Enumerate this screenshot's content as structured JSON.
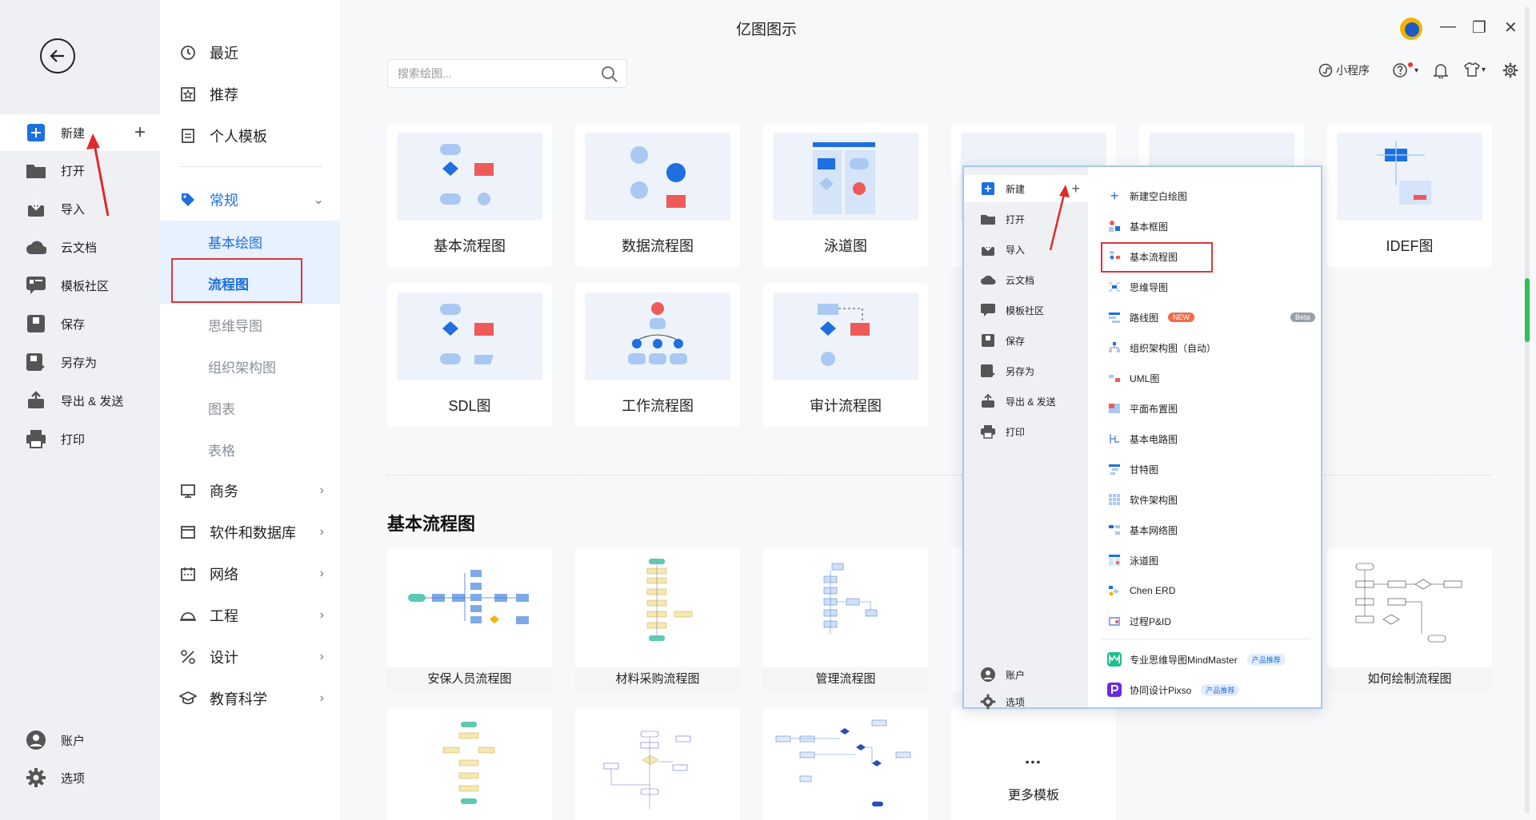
{
  "app": {
    "title": "亿图图示"
  },
  "rail": {
    "items": [
      {
        "label": "新建",
        "icon": "plus-square-icon"
      },
      {
        "label": "打开",
        "icon": "folder-icon"
      },
      {
        "label": "导入",
        "icon": "import-icon"
      },
      {
        "label": "云文档",
        "icon": "cloud-icon"
      },
      {
        "label": "模板社区",
        "icon": "community-icon"
      },
      {
        "label": "保存",
        "icon": "save-icon"
      },
      {
        "label": "另存为",
        "icon": "save-as-icon"
      },
      {
        "label": "导出 & 发送",
        "icon": "export-icon"
      },
      {
        "label": "打印",
        "icon": "print-icon"
      }
    ],
    "bottom": [
      {
        "label": "账户",
        "icon": "user-icon"
      },
      {
        "label": "选项",
        "icon": "gear-icon"
      }
    ]
  },
  "categories": {
    "top": [
      "最近",
      "推荐",
      "个人模板"
    ],
    "group": "常规",
    "sub": [
      "基本绘图",
      "流程图",
      "思维导图",
      "组织架构图",
      "图表",
      "表格"
    ],
    "more": [
      "商务",
      "软件和数据库",
      "网络",
      "工程",
      "设计",
      "教育科学"
    ]
  },
  "search": {
    "placeholder": "搜索绘图..."
  },
  "toolbar": {
    "miniprogram": "小程序"
  },
  "types": [
    "基本流程图",
    "数据流程图",
    "泳道图",
    "IDEF图",
    "SDL图",
    "工作流程图",
    "审计流程图"
  ],
  "section": {
    "title": "基本流程图"
  },
  "templates": [
    "安保人员流程图",
    "材料采购流程图",
    "管理流程图",
    "如何绘制流程图"
  ],
  "more_templates": {
    "dots": "•••",
    "label": "更多模板"
  },
  "popup": {
    "left": [
      "新建",
      "打开",
      "导入",
      "云文档",
      "模板社区",
      "保存",
      "另存为",
      "导出 & 发送",
      "打印"
    ],
    "left_bottom": [
      "账户",
      "选项"
    ],
    "options": [
      "新建空白绘图",
      "基本框图",
      "基本流程图",
      "思维导图",
      "路线图",
      "组织架构图（自动）",
      "UML图",
      "平面布置图",
      "基本电路图",
      "甘特图",
      "软件架构图",
      "基本网络图",
      "泳道图",
      "Chen ERD",
      "过程P&ID"
    ],
    "new_badge": "NEW",
    "beta_badge": "Beta",
    "promos": [
      {
        "label": "专业思维导图MindMaster",
        "badge": "产品推荐"
      },
      {
        "label": "协同设计Pixso",
        "badge": "产品推荐"
      }
    ]
  },
  "colors": {
    "accent": "#1e6fe0",
    "highlight": "#d9363e"
  }
}
